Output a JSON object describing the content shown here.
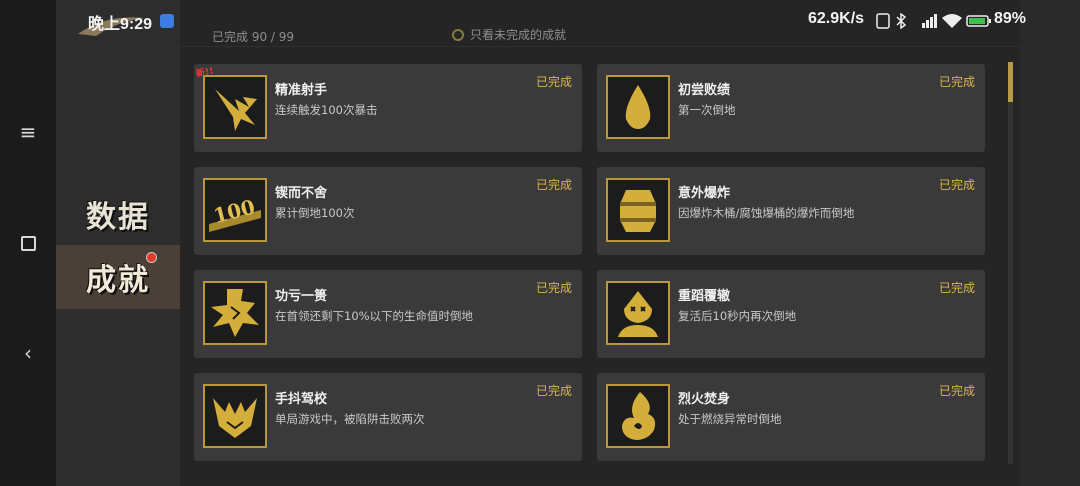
{
  "status_bar": {
    "time": "晚上9:29",
    "net_speed": "62.9K/s",
    "battery": "89%"
  },
  "sidebar": {
    "categories": [
      "数据",
      "成就"
    ],
    "active": "成就"
  },
  "header": {
    "progress": "已完成 90 / 99",
    "filter_label": "只看未完成的成就"
  },
  "achievements": [
    {
      "title": "精准射手",
      "desc": "连续触发100次暴击",
      "status": "已完成",
      "is_new": true,
      "new_label": "新!!",
      "icon": "starburst-icon"
    },
    {
      "title": "初尝败绩",
      "desc": "第一次倒地",
      "status": "已完成",
      "icon": "drop-icon"
    },
    {
      "title": "锲而不舍",
      "desc": "累计倒地100次",
      "status": "已完成",
      "icon": "hundred-icon",
      "icon_text": "100"
    },
    {
      "title": "意外爆炸",
      "desc": "因爆炸木桶/腐蚀爆桶的爆炸而倒地",
      "status": "已完成",
      "icon": "barrel-icon"
    },
    {
      "title": "功亏一篑",
      "desc": "在首领还剩下10%以下的生命值时倒地",
      "status": "已完成",
      "icon": "broken-star-icon"
    },
    {
      "title": "重蹈覆辙",
      "desc": "复活后10秒内再次倒地",
      "status": "已完成",
      "icon": "knocked-out-icon"
    },
    {
      "title": "手抖驾校",
      "desc": "单局游戏中，被陷阱击败两次",
      "status": "已完成",
      "icon": "trap-icon"
    },
    {
      "title": "烈火焚身",
      "desc": "处于燃烧异常时倒地",
      "status": "已完成",
      "icon": "flame-icon"
    }
  ],
  "colors": {
    "accent_gold": "#d9b64c",
    "card_bg": "#3a3a3a",
    "badge_red": "#e23a2d"
  }
}
